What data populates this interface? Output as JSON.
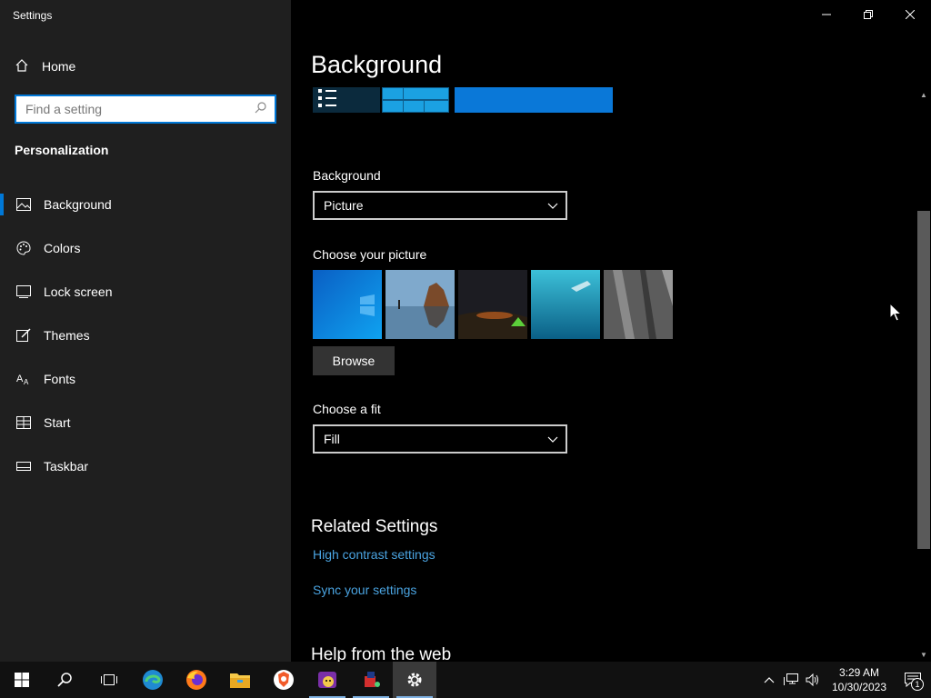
{
  "window": {
    "title": "Settings",
    "controls": {
      "minimize_icon": "minimize-icon",
      "restore_icon": "restore-icon",
      "close_icon": "close-icon"
    }
  },
  "sidebar": {
    "home_label": "Home",
    "search_placeholder": "Find a setting",
    "section_title": "Personalization",
    "items": [
      {
        "label": "Background",
        "icon": "picture-icon",
        "active": true
      },
      {
        "label": "Colors",
        "icon": "palette-icon",
        "active": false
      },
      {
        "label": "Lock screen",
        "icon": "lock-screen-icon",
        "active": false
      },
      {
        "label": "Themes",
        "icon": "themes-icon",
        "active": false
      },
      {
        "label": "Fonts",
        "icon": "fonts-icon",
        "active": false
      },
      {
        "label": "Start",
        "icon": "start-icon",
        "active": false
      },
      {
        "label": "Taskbar",
        "icon": "taskbar-icon",
        "active": false
      }
    ]
  },
  "main": {
    "title": "Background",
    "background_label": "Background",
    "background_value": "Picture",
    "choose_picture_label": "Choose your picture",
    "pictures": [
      "windows-blue",
      "beach-rock",
      "night-sky-tent",
      "underwater-swimmer",
      "rock-cliff"
    ],
    "browse_label": "Browse",
    "fit_label": "Choose a fit",
    "fit_value": "Fill",
    "related_title": "Related Settings",
    "links": [
      "High contrast settings",
      "Sync your settings"
    ],
    "help_title": "Help from the web"
  },
  "scroll": {
    "thumb_start_fraction": 0.2,
    "thumb_size_fraction": 0.62
  },
  "taskbar": {
    "apps": [
      "windows-start-icon",
      "search-icon",
      "task-view-icon",
      "edge-icon",
      "firefox-icon",
      "file-explorer-icon",
      "brave-icon",
      "app-icon",
      "paint-app-icon",
      "settings-gear-icon"
    ],
    "time": "3:29 AM",
    "date": "10/30/2023",
    "notification_count": "1"
  },
  "colors": {
    "accent": "#0078d7",
    "sidebar_bg": "#1f1f1f",
    "main_bg": "#000000",
    "link": "#4aa3e0"
  }
}
